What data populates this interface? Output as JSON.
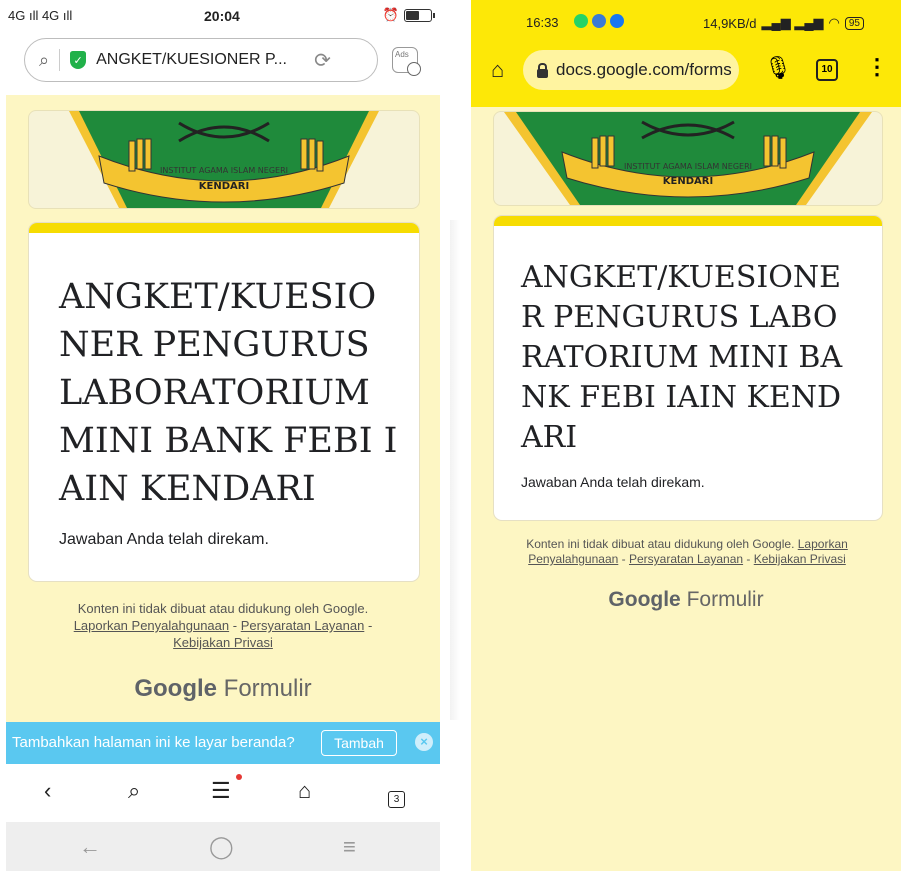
{
  "left": {
    "status": {
      "signal": "4G ıll 4G ıll",
      "time": "20:04",
      "battery_level": 0.55
    },
    "browser": {
      "page_title": "ANGKET/KUESIONER P...",
      "ads_label": "Ads"
    },
    "form": {
      "title": "ANGKET/KUESIONER PENGURUS LABORATORIUM MINI BANK FEBI IAIN KENDARI",
      "response": "Jawaban Anda telah direkam.",
      "logo_text": "INSTITUT AGAMA ISLAM NEGERI",
      "logo_subtext": "KENDARI"
    },
    "footer": {
      "disclaimer": "Konten ini tidak dibuat atau didukung oleh Google.",
      "link_report": "Laporkan Penyalahgunaan",
      "link_terms": "Persyaratan Layanan",
      "link_privacy": "Kebijakan Privasi",
      "dash": "-",
      "brand_google": "Google",
      "brand_forms": "Formulir"
    },
    "prompt": {
      "text": "Tambahkan halaman ini ke layar beranda?",
      "button": "Tambah"
    },
    "nav": {
      "tab_count": "3"
    }
  },
  "right": {
    "status": {
      "time": "16:33",
      "speed": "14,9KB/d",
      "battery": "95"
    },
    "browser": {
      "url": "docs.google.com/forms",
      "tab_count": "10"
    },
    "form": {
      "title": "ANGKET/KUESIONER PENGURUS LABORATORIUM MINI BANK FEBI IAIN KENDARI",
      "response": "Jawaban Anda telah direkam.",
      "logo_text": "INSTITUT AGAMA ISLAM NEGERI",
      "logo_subtext": "KENDARI"
    },
    "footer": {
      "disclaimer": "Konten ini tidak dibuat atau didukung oleh Google.",
      "link_report": "Laporkan Penyalahgunaan",
      "link_terms": "Persyaratan Layanan",
      "link_privacy": "Kebijakan Privasi",
      "dash": "-",
      "brand_google": "Google",
      "brand_forms": "Formulir"
    }
  },
  "colors": {
    "theme_yellow": "#f6dc02",
    "page_bg": "#fdf6c3",
    "prompt_blue": "#5ac8f0",
    "logo_green": "#1f8a3b",
    "logo_gold": "#f4c430"
  },
  "icons": [
    "search-icon",
    "shield-icon",
    "reload-icon",
    "ad-block-icon",
    "back-icon",
    "menu-icon",
    "home-icon",
    "tabs-icon",
    "mic-icon",
    "more-icon",
    "lock-icon",
    "close-icon"
  ]
}
